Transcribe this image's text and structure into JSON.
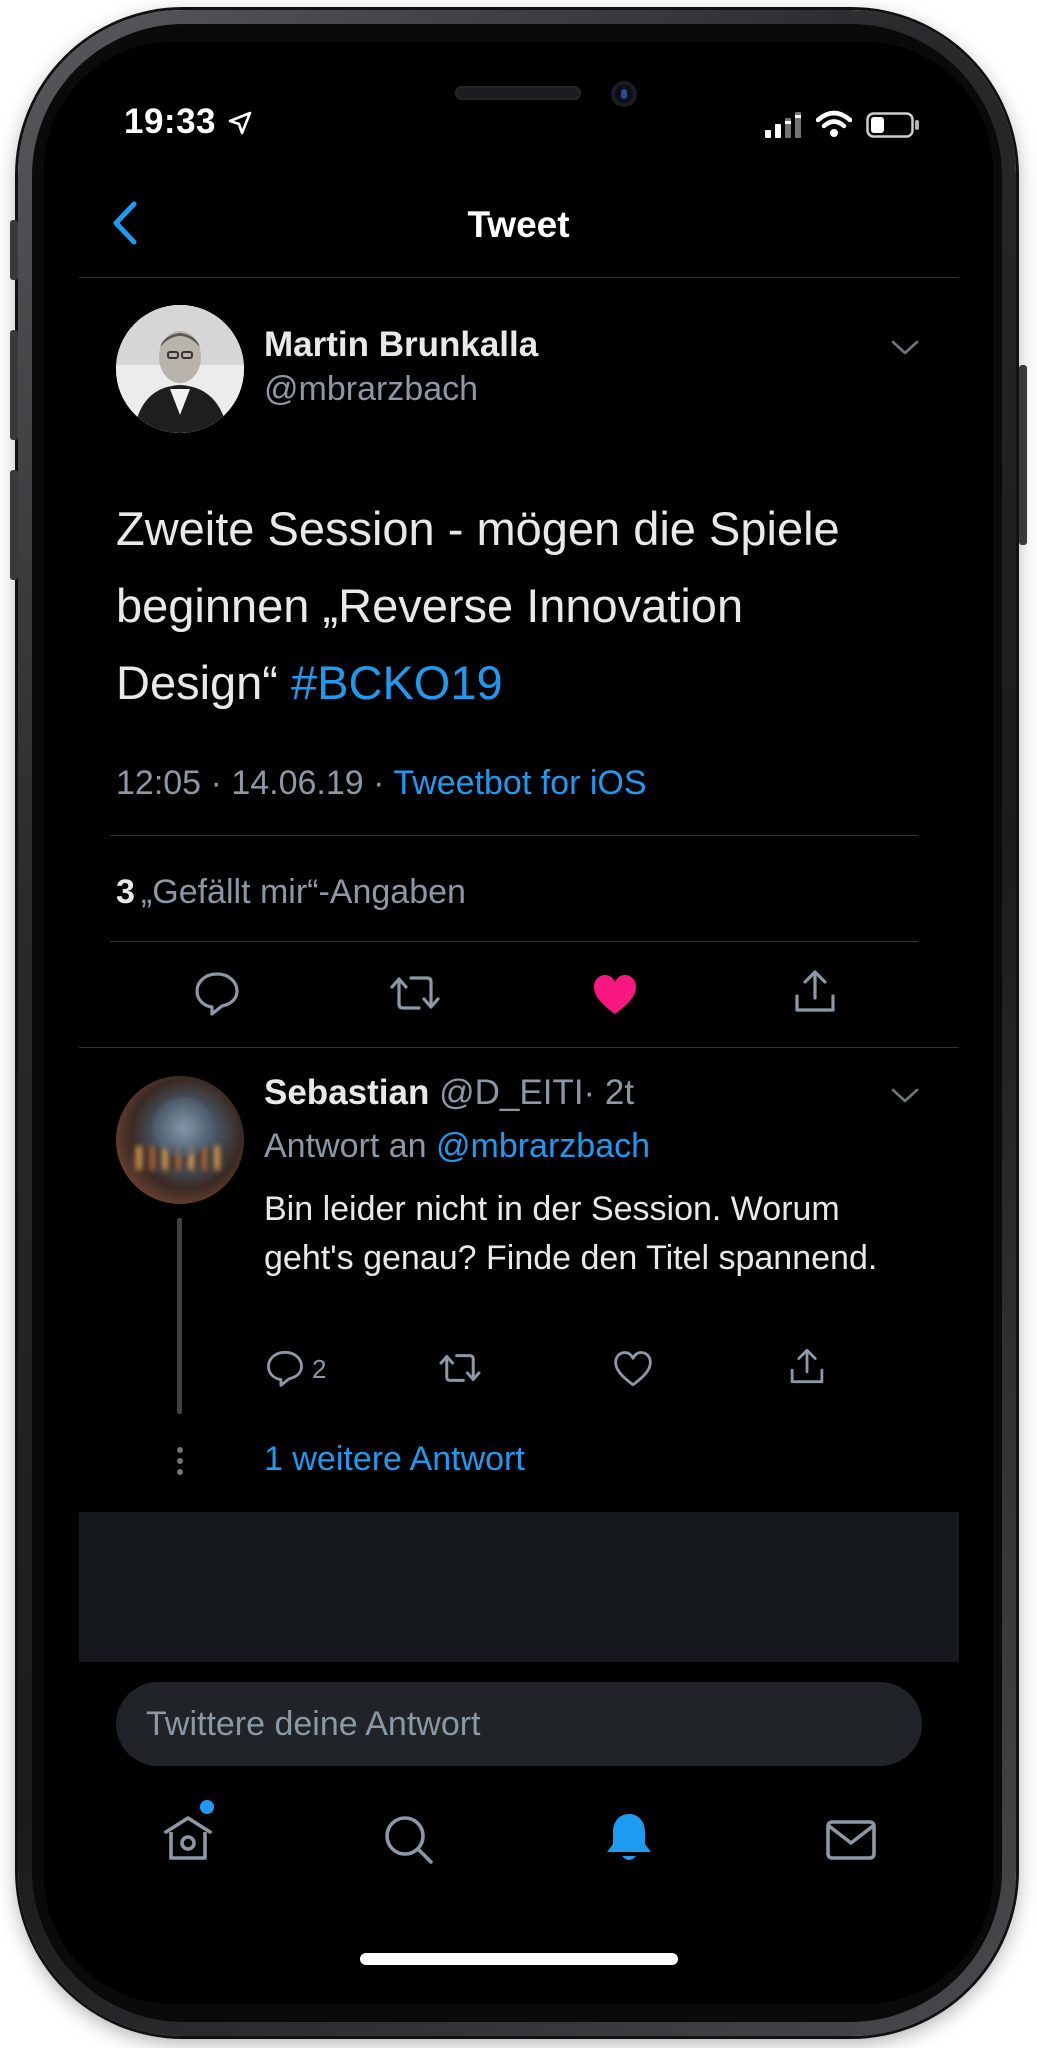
{
  "status_bar": {
    "time": "19:33"
  },
  "header": {
    "title": "Tweet"
  },
  "tweet": {
    "author_name": "Martin Brunkalla",
    "author_handle": "@mbrarzbach",
    "text": "Zweite Session - mögen die Spiele beginnen „Reverse Innovation Design“",
    "hashtag": "#BCKO19",
    "time": "12:05",
    "date": "14.06.19",
    "separator": "·",
    "source": "Tweetbot for iOS",
    "likes_count": "3",
    "likes_label": "„Gefällt mir“-Angaben"
  },
  "reply": {
    "author_name": "Sebastian",
    "author_handle": "@D_EITI",
    "age": "· 2t",
    "reply_to_label": "Antwort an",
    "reply_to_handle": "@mbrarzbach",
    "text": "Bin leider nicht in der Session. Worum geht's genau? Finde den Titel spannend.",
    "reply_count": "2",
    "more_replies": "1 weitere Antwort"
  },
  "compose": {
    "placeholder": "Twittere deine Antwort"
  },
  "colors": {
    "accent": "#1d9bf0",
    "like": "#f91880",
    "background": "#000000",
    "secondary_text": "#8b98a5"
  },
  "icons": {
    "back": "chevron-left-icon",
    "reply": "comment-icon",
    "retweet": "retweet-icon",
    "like": "heart-icon",
    "share": "share-icon",
    "tabs": [
      "home-icon",
      "search-icon",
      "bell-icon",
      "mail-icon"
    ]
  }
}
